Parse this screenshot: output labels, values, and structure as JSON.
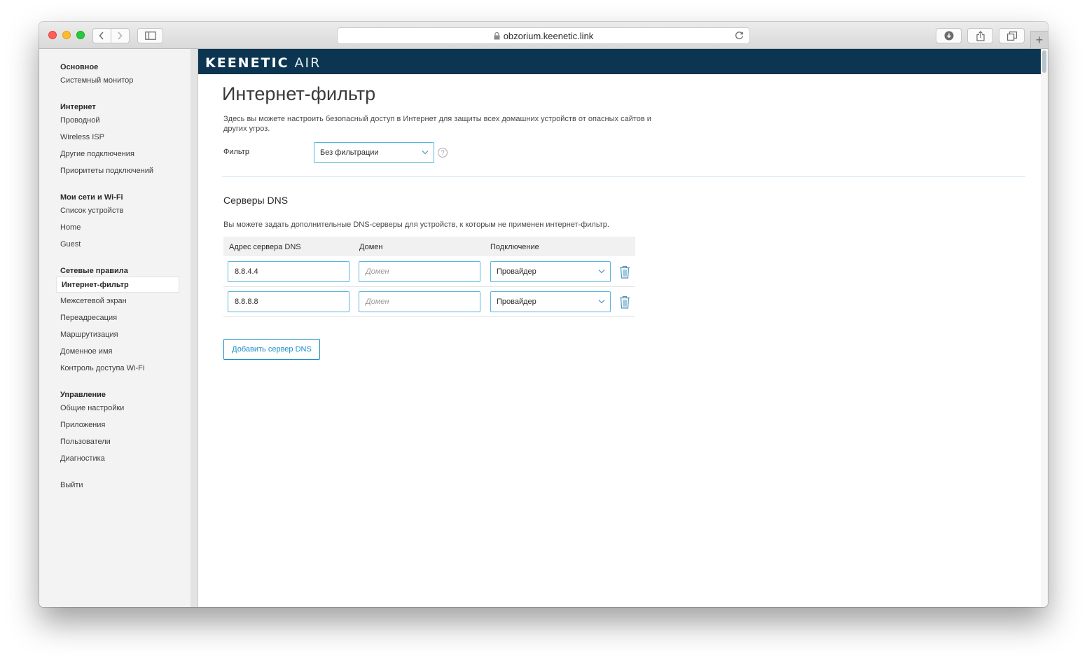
{
  "browser": {
    "url": "obzorium.keenetic.link"
  },
  "brand": {
    "name": "KEENETIC",
    "model": "AIR"
  },
  "sidebar": {
    "sections": [
      {
        "title": "Основное",
        "items": [
          "Системный монитор"
        ]
      },
      {
        "title": "Интернет",
        "items": [
          "Проводной",
          "Wireless ISP",
          "Другие подключения",
          "Приоритеты подключений"
        ]
      },
      {
        "title": "Мои сети и Wi-Fi",
        "items": [
          "Список устройств",
          "Home",
          "Guest"
        ]
      },
      {
        "title": "Сетевые правила",
        "items": [
          "Интернет-фильтр",
          "Межсетевой экран",
          "Переадресация",
          "Маршрутизация",
          "Доменное имя",
          "Контроль доступа Wi-Fi"
        ]
      },
      {
        "title": "Управление",
        "items": [
          "Общие настройки",
          "Приложения",
          "Пользователи",
          "Диагностика"
        ]
      }
    ],
    "active_item": "Интернет-фильтр",
    "logout": "Выйти"
  },
  "main": {
    "title": "Интернет-фильтр",
    "description": "Здесь вы можете настроить безопасный доступ в Интернет для защиты всех домашних устройств от опасных сайтов и других угроз.",
    "filter_label": "Фильтр",
    "filter_value": "Без фильтрации",
    "help": "?",
    "dns_section": {
      "title": "Серверы DNS",
      "description": "Вы можете задать дополнительные DNS-серверы для устройств, к которым не применен интернет-фильтр.",
      "columns": [
        "Адрес сервера DNS",
        "Домен",
        "Подключение"
      ],
      "rows": [
        {
          "address": "8.8.4.4",
          "domain_placeholder": "Домен",
          "connection": "Провайдер"
        },
        {
          "address": "8.8.8.8",
          "domain_placeholder": "Домен",
          "connection": "Провайдер"
        }
      ],
      "add_button": "Добавить сервер DNS"
    }
  },
  "colors": {
    "brand_bar": "#0b3550",
    "accent": "#1a8fc4",
    "input_border": "#59b6e0",
    "trash_icon": "#4a94bd"
  }
}
